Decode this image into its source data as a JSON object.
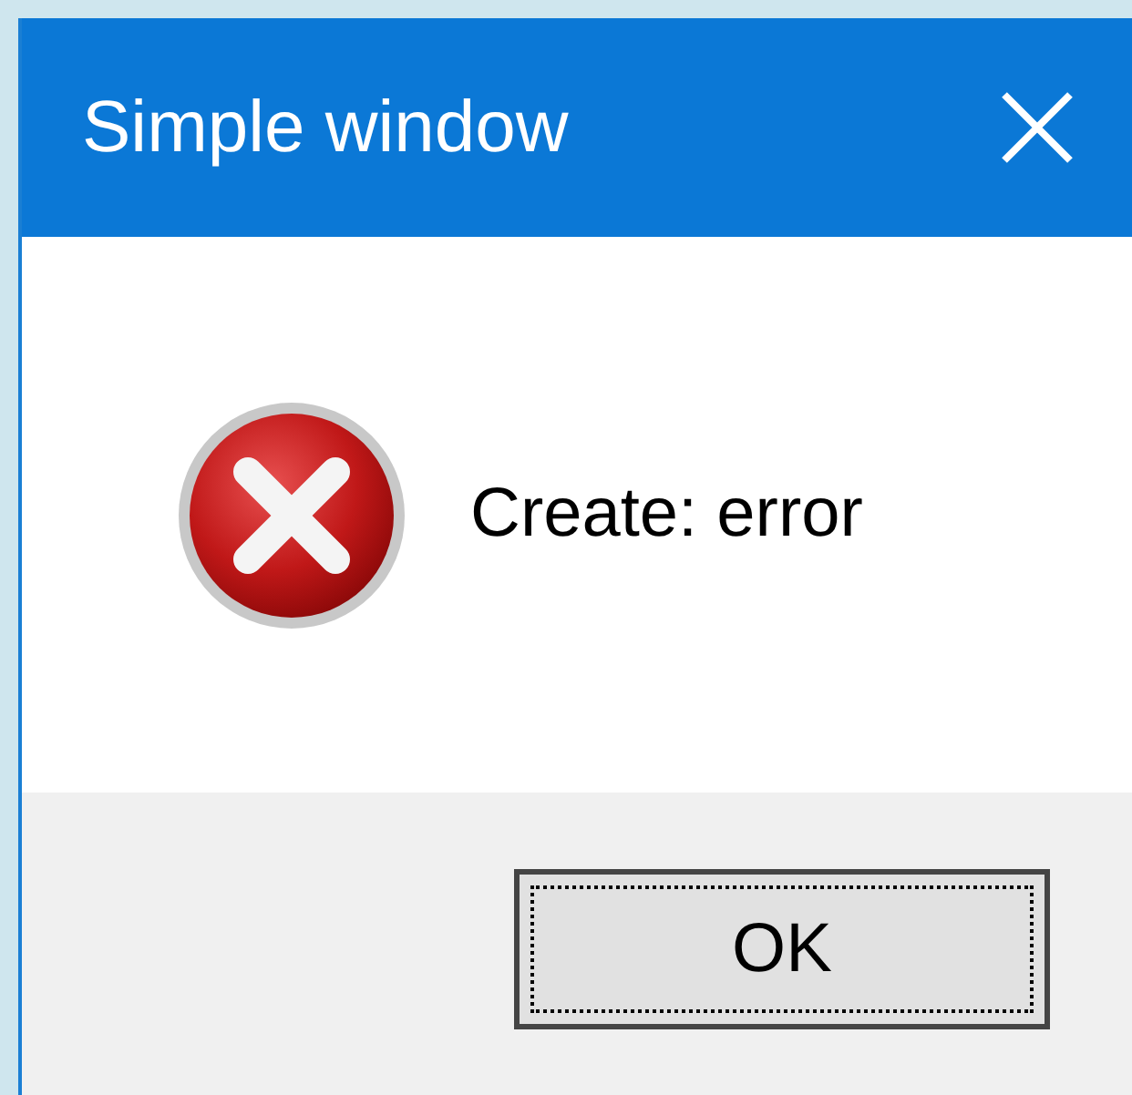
{
  "window": {
    "title": "Simple window"
  },
  "message": {
    "kind": "error",
    "text": "Create: error"
  },
  "buttons": [
    {
      "label": "OK",
      "focused": true
    }
  ]
}
